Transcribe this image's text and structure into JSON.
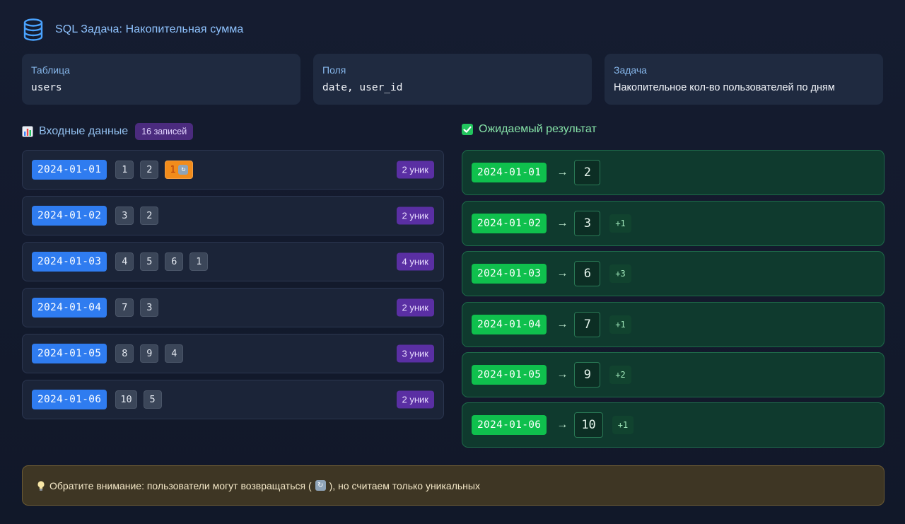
{
  "header": {
    "icon": "database-icon",
    "title": "SQL Задача: Накопительная сумма"
  },
  "info": [
    {
      "label": "Таблица",
      "value": "users"
    },
    {
      "label": "Поля",
      "value": "date, user_id"
    },
    {
      "label": "Задача",
      "value": "Накопительное кол-во пользователей по дням"
    }
  ],
  "input": {
    "title": "Входные данные",
    "icon": "bar-chart-emoji-icon",
    "count": "16 записей",
    "rows": [
      {
        "date": "2024-01-01",
        "users": [
          "1",
          "2"
        ],
        "repeat": "1",
        "uniq": "2 уник"
      },
      {
        "date": "2024-01-02",
        "users": [
          "3",
          "2"
        ],
        "uniq": "2 уник"
      },
      {
        "date": "2024-01-03",
        "users": [
          "4",
          "5",
          "6",
          "1"
        ],
        "uniq": "4 уник"
      },
      {
        "date": "2024-01-04",
        "users": [
          "7",
          "3"
        ],
        "uniq": "2 уник"
      },
      {
        "date": "2024-01-05",
        "users": [
          "8",
          "9",
          "4"
        ],
        "uniq": "3 уник"
      },
      {
        "date": "2024-01-06",
        "users": [
          "10",
          "5"
        ],
        "uniq": "2 уник"
      }
    ]
  },
  "output": {
    "title": "Ожидаемый результат",
    "icon": "check-mark-emoji-icon",
    "arrow": "→",
    "rows": [
      {
        "date": "2024-01-01",
        "total": "2",
        "delta": ""
      },
      {
        "date": "2024-01-02",
        "total": "3",
        "delta": "+1"
      },
      {
        "date": "2024-01-03",
        "total": "6",
        "delta": "+3"
      },
      {
        "date": "2024-01-04",
        "total": "7",
        "delta": "+1"
      },
      {
        "date": "2024-01-05",
        "total": "9",
        "delta": "+2"
      },
      {
        "date": "2024-01-06",
        "total": "10",
        "delta": "+1"
      }
    ]
  },
  "note": {
    "icon": "lightbulb-icon",
    "text_before": "Обратите внимание: пользователи могут возвращаться (",
    "text_after": "), но считаем только уникальных"
  },
  "colors": {
    "accent_blue": "#2f7cf0",
    "accent_green": "#0fc04d",
    "repeat_orange": "#f28c1b",
    "badge_purple": "#5a2fa3"
  }
}
